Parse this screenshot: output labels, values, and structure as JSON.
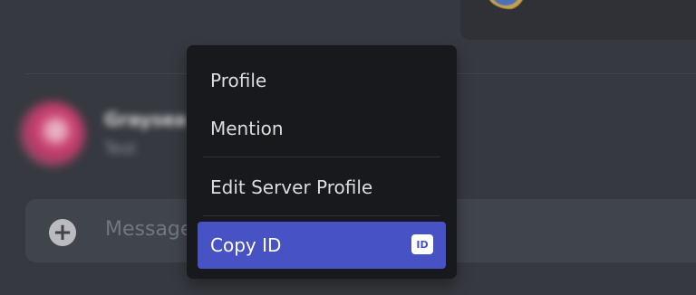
{
  "colors": {
    "background": "#36393f",
    "menu_background": "#18191c",
    "accent": "#4752c4",
    "message_bar": "#40444b"
  },
  "member": {
    "name": "Graysea",
    "subtext": "Test"
  },
  "composer": {
    "placeholder": "Message",
    "add_icon": "plus-circle-icon"
  },
  "context_menu": {
    "items": [
      {
        "label": "Profile"
      },
      {
        "label": "Mention"
      },
      {
        "label": "Edit Server Profile"
      },
      {
        "label": "Copy ID",
        "badge": "ID",
        "highlighted": true
      }
    ]
  }
}
